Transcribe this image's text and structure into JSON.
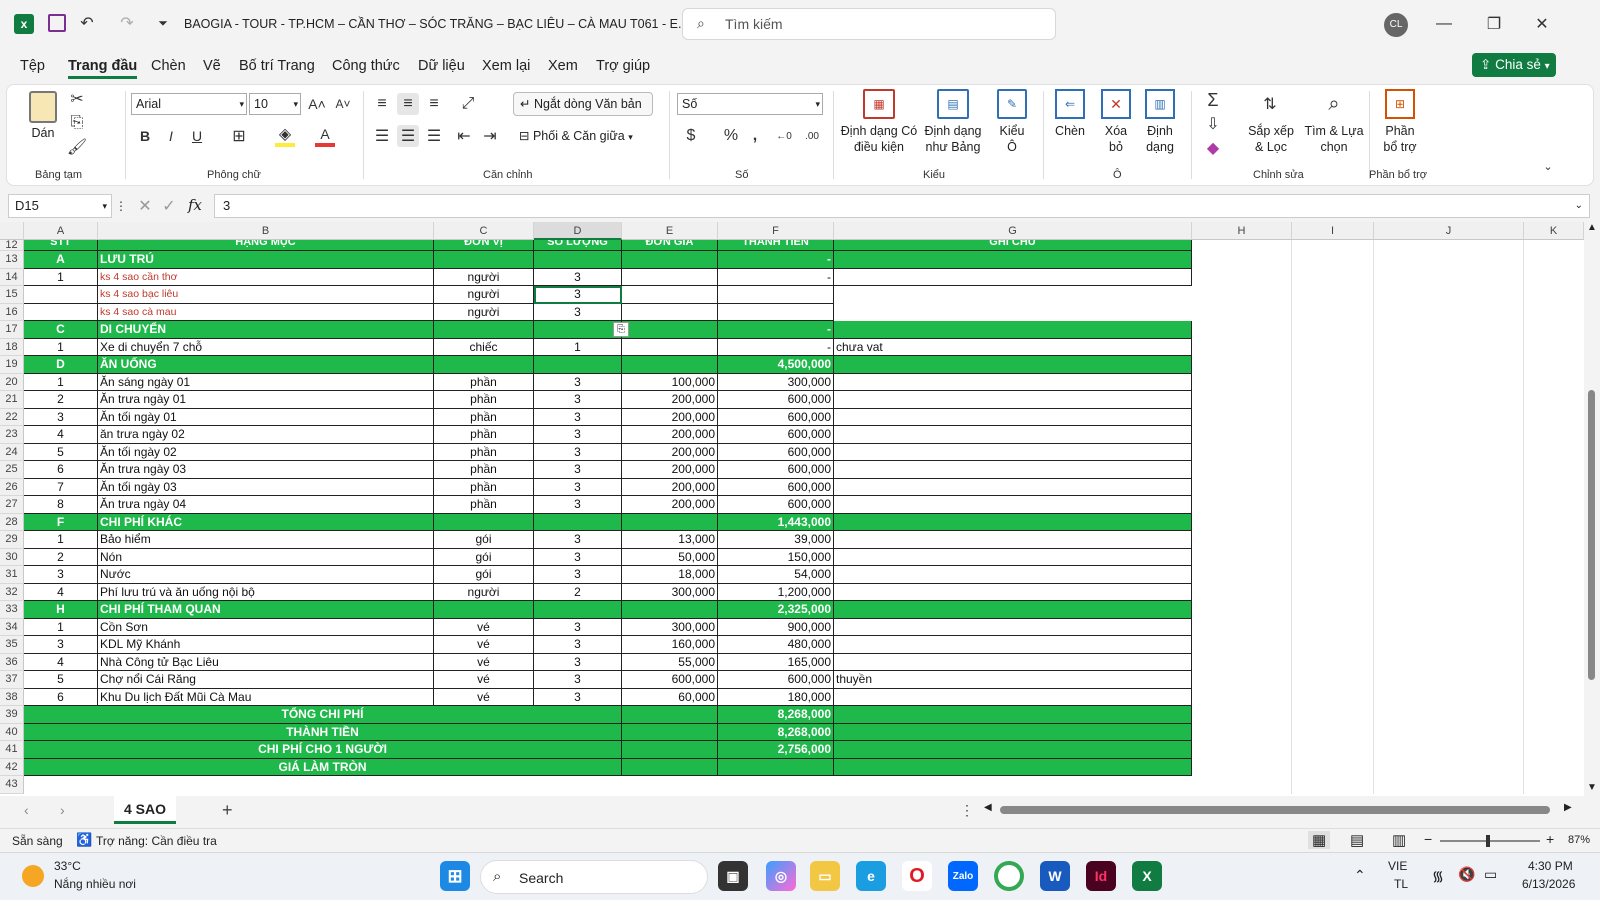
{
  "window": {
    "title": "BAOGIA - TOUR - TP.HCM – CẦN THƠ – SÓC TRĂNG – BẠC LIÊU – CÀ MAU T061 - E...",
    "search_placeholder": "Tìm kiếm",
    "user_initials": "CL"
  },
  "menu": [
    "Tệp",
    "Trang đầu",
    "Chèn",
    "Vẽ",
    "Bố trí Trang",
    "Công thức",
    "Dữ liệu",
    "Xem lại",
    "Xem",
    "Trợ giúp"
  ],
  "share_label": "Chia sẻ",
  "ribbon": {
    "paste": "Dán",
    "clipboard_group": "Bảng tạm",
    "font_name": "Arial",
    "font_size": "10",
    "font_group": "Phông chữ",
    "wrap_text": "Ngắt dòng Văn bản",
    "merge_center": "Phối & Căn giữa",
    "alignment_group": "Căn chỉnh",
    "number_format": "Số",
    "number_group": "Số",
    "cond_format_1": "Định dạng Có",
    "cond_format_2": "điều kiện",
    "format_table_1": "Định dạng",
    "format_table_2": "như Bảng",
    "cell_styles_1": "Kiểu",
    "cell_styles_2": "Ô",
    "styles_group": "Kiểu",
    "insert": "Chèn",
    "delete_1": "Xóa",
    "delete_2": "bỏ",
    "format_1": "Định",
    "format_2": "dạng",
    "cells_group": "Ô",
    "sort_1": "Sắp xếp",
    "sort_2": "& Lọc",
    "find_1": "Tìm & Lựa",
    "find_2": "chọn",
    "editing_group": "Chỉnh sửa",
    "addins_1": "Phần",
    "addins_2": "bổ trợ",
    "addins_group": "Phần bổ trợ"
  },
  "formula_bar": {
    "name_box": "D15",
    "fx": "fx",
    "value": "3"
  },
  "columns": [
    "A",
    "B",
    "C",
    "D",
    "E",
    "F",
    "G",
    "H",
    "I",
    "J",
    "K"
  ],
  "header_row": {
    "num": "12",
    "a": "STT",
    "b": "HẠNG MỤC",
    "c": "ĐƠN VỊ",
    "d": "SỐ LƯỢNG",
    "e": "ĐƠN GIÁ",
    "f": "THÀNH TIỀN",
    "g": "GHI CHÚ"
  },
  "rows": [
    {
      "num": "13",
      "t": "s",
      "a": "A",
      "b": "LƯU TRÚ",
      "c": "",
      "d": "",
      "e": "",
      "f": "-",
      "g": ""
    },
    {
      "num": "14",
      "t": "d",
      "a": "1",
      "b": "ks 4 sao cần thơ",
      "c": "người",
      "d": "3",
      "e": "",
      "f": "-",
      "g": "",
      "red": true
    },
    {
      "num": "15",
      "t": "d",
      "a": "",
      "b": "ks 4 sao bạc liêu",
      "c": "người",
      "d": "3",
      "e": "",
      "f": "",
      "g": "",
      "red": true
    },
    {
      "num": "16",
      "t": "d",
      "a": "",
      "b": "ks 4 sao cà mau",
      "c": "người",
      "d": "3",
      "e": "",
      "f": "",
      "g": "",
      "red": true
    },
    {
      "num": "17",
      "t": "s",
      "a": "C",
      "b": "DI CHUYỂN",
      "c": "",
      "d": "",
      "e": "",
      "f": "-",
      "g": ""
    },
    {
      "num": "18",
      "t": "d",
      "a": "1",
      "b": "Xe di chuyển 7 chỗ",
      "c": "chiếc",
      "d": "1",
      "e": "",
      "f": "-",
      "g": "chưa vat"
    },
    {
      "num": "19",
      "t": "s",
      "a": "D",
      "b": "ĂN UỐNG",
      "c": "",
      "d": "",
      "e": "",
      "f": "4,500,000",
      "g": ""
    },
    {
      "num": "20",
      "t": "d",
      "a": "1",
      "b": "Ăn sáng ngày 01",
      "c": "phần",
      "d": "3",
      "e": "100,000",
      "f": "300,000",
      "g": ""
    },
    {
      "num": "21",
      "t": "d",
      "a": "2",
      "b": "Ăn trưa ngày 01",
      "c": "phần",
      "d": "3",
      "e": "200,000",
      "f": "600,000",
      "g": ""
    },
    {
      "num": "22",
      "t": "d",
      "a": "3",
      "b": "Ăn tối ngày 01",
      "c": "phần",
      "d": "3",
      "e": "200,000",
      "f": "600,000",
      "g": ""
    },
    {
      "num": "23",
      "t": "d",
      "a": "4",
      "b": "ăn trưa ngày  02",
      "c": "phần",
      "d": "3",
      "e": "200,000",
      "f": "600,000",
      "g": ""
    },
    {
      "num": "24",
      "t": "d",
      "a": "5",
      "b": "Ăn tối ngày 02",
      "c": "phần",
      "d": "3",
      "e": "200,000",
      "f": "600,000",
      "g": ""
    },
    {
      "num": "25",
      "t": "d",
      "a": "6",
      "b": "Ăn trưa ngày 03",
      "c": "phần",
      "d": "3",
      "e": "200,000",
      "f": "600,000",
      "g": ""
    },
    {
      "num": "26",
      "t": "d",
      "a": "7",
      "b": "Ăn tối ngày 03",
      "c": "phần",
      "d": "3",
      "e": "200,000",
      "f": "600,000",
      "g": ""
    },
    {
      "num": "27",
      "t": "d",
      "a": "8",
      "b": "Ăn trưa ngày 04",
      "c": "phần",
      "d": "3",
      "e": "200,000",
      "f": "600,000",
      "g": ""
    },
    {
      "num": "28",
      "t": "s",
      "a": "F",
      "b": "CHI PHÍ KHÁC",
      "c": "",
      "d": "",
      "e": "",
      "f": "1,443,000",
      "g": ""
    },
    {
      "num": "29",
      "t": "d",
      "a": "1",
      "b": "Bảo hiểm",
      "c": "gói",
      "d": "3",
      "e": "13,000",
      "f": "39,000",
      "g": ""
    },
    {
      "num": "30",
      "t": "d",
      "a": "2",
      "b": "Nón",
      "c": "gói",
      "d": "3",
      "e": "50,000",
      "f": "150,000",
      "g": ""
    },
    {
      "num": "31",
      "t": "d",
      "a": "3",
      "b": "Nước",
      "c": "gói",
      "d": "3",
      "e": "18,000",
      "f": "54,000",
      "g": ""
    },
    {
      "num": "32",
      "t": "d",
      "a": "4",
      "b": "Phí lưu trú và ăn uống nội bộ",
      "c": "người",
      "d": "2",
      "e": "300,000",
      "f": "1,200,000",
      "g": ""
    },
    {
      "num": "33",
      "t": "s",
      "a": "H",
      "b": "CHI PHÍ THAM QUAN",
      "c": "",
      "d": "",
      "e": "",
      "f": "2,325,000",
      "g": ""
    },
    {
      "num": "34",
      "t": "d",
      "a": "1",
      "b": "Cồn Sơn",
      "c": "vé",
      "d": "3",
      "e": "300,000",
      "f": "900,000",
      "g": ""
    },
    {
      "num": "35",
      "t": "d",
      "a": "3",
      "b": "KDL Mỹ Khánh",
      "c": "vé",
      "d": "3",
      "e": "160,000",
      "f": "480,000",
      "g": ""
    },
    {
      "num": "36",
      "t": "d",
      "a": "4",
      "b": "Nhà Công tử Bạc Liêu",
      "c": "vé",
      "d": "3",
      "e": "55,000",
      "f": "165,000",
      "g": ""
    },
    {
      "num": "37",
      "t": "d",
      "a": "5",
      "b": "Chợ nổi Cái Răng",
      "c": "vé",
      "d": "3",
      "e": "600,000",
      "f": "600,000",
      "g": "thuyền"
    },
    {
      "num": "38",
      "t": "d",
      "a": "6",
      "b": "Khu Du lịch Đất Mũi Cà Mau",
      "c": "vé",
      "d": "3",
      "e": "60,000",
      "f": "180,000",
      "g": ""
    },
    {
      "num": "39",
      "t": "t",
      "label": "TỔNG CHI PHÍ",
      "f": "8,268,000"
    },
    {
      "num": "40",
      "t": "t",
      "label": "THÀNH TIỀN",
      "f": "8,268,000"
    },
    {
      "num": "41",
      "t": "t",
      "label": "CHI PHÍ CHO 1 NGƯỜI",
      "f": "2,756,000"
    },
    {
      "num": "42",
      "t": "t",
      "label": "GIÁ LÀM TRÒN",
      "f": ""
    },
    {
      "num": "43",
      "t": "e"
    }
  ],
  "sheet_tab": "4 SAO",
  "status": {
    "ready": "Sẵn sàng",
    "accessibility": "Trợ năng: Cần điều tra",
    "zoom": "87%"
  },
  "taskbar": {
    "weather_temp": "33°C",
    "weather_desc": "Nắng nhiều nơi",
    "search": "Search",
    "lang_1": "VIE",
    "lang_2": "TL",
    "time": "4:30 PM",
    "date": "6/13/2026"
  },
  "colors": {
    "accent": "#107c41",
    "section_green": "#1fb84a"
  }
}
